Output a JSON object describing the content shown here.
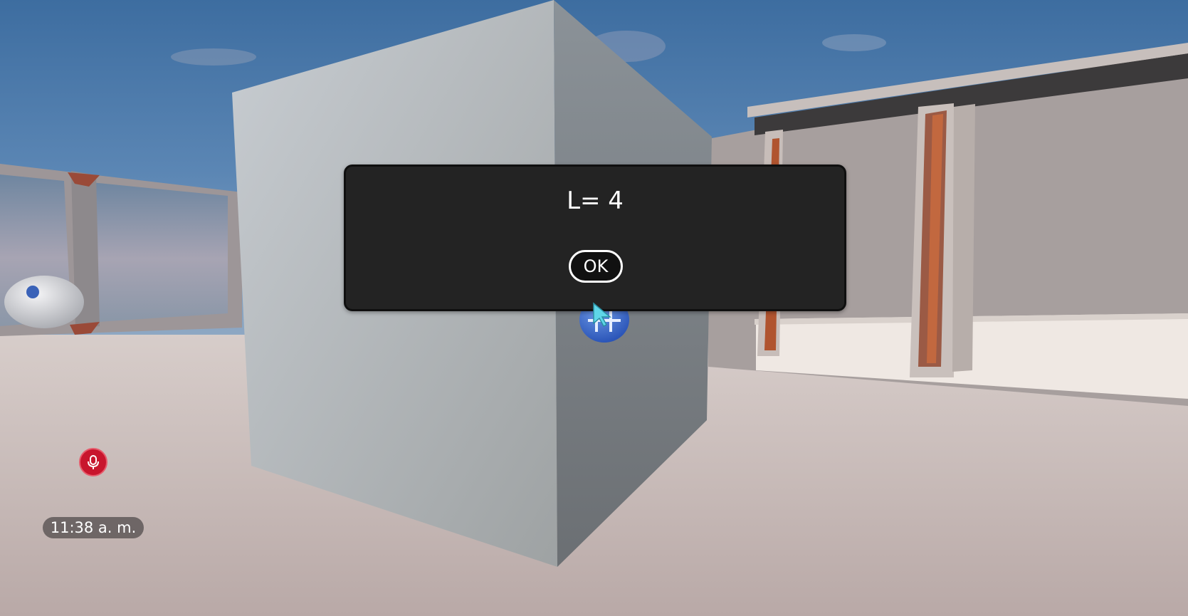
{
  "dialog": {
    "message": "L= 4",
    "ok_label": "OK"
  },
  "hud": {
    "clock": "11:38 a. m.",
    "mic_icon": "microphone-icon"
  },
  "scene": {
    "cursor_icon": "pointer-cursor-icon",
    "teleport_marker_icon": "teleport-marker-icon",
    "sky_color": "#4e7cac",
    "floor_color": "#c9bcb9",
    "cube_color": "#b9bec4",
    "accent_color": "#c8152d"
  }
}
